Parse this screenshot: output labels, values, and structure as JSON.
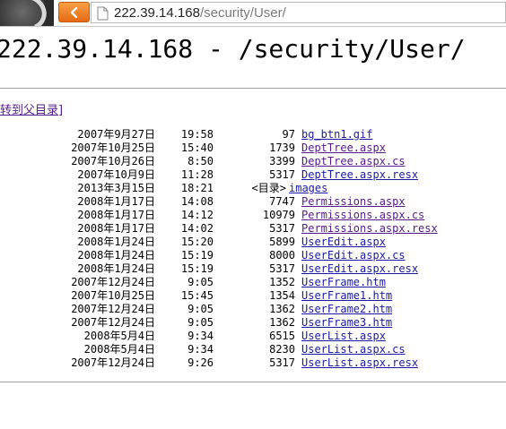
{
  "browser": {
    "url_host": "222.39.14.168",
    "url_path": "/security/User/"
  },
  "page": {
    "heading": "222.39.14.168 - /security/User/",
    "parent_link": "转到父目录]"
  },
  "dir_label": "<目录>",
  "files": [
    {
      "date": "2007年9月27日",
      "time": "19:58",
      "size": "97",
      "name": "bg_btn1.gif",
      "visited": false
    },
    {
      "date": "2007年10月25日",
      "time": "15:40",
      "size": "1739",
      "name": "DeptTree.aspx",
      "visited": true
    },
    {
      "date": "2007年10月26日",
      "time": "8:50",
      "size": "3399",
      "name": "DeptTree.aspx.cs",
      "visited": true
    },
    {
      "date": "2007年10月9日",
      "time": "11:28",
      "size": "5317",
      "name": "DeptTree.aspx.resx",
      "visited": false
    },
    {
      "date": "2013年3月15日",
      "time": "18:21",
      "size": "",
      "name": "images",
      "visited": false,
      "is_dir": true
    },
    {
      "date": "2008年1月17日",
      "time": "14:08",
      "size": "7747",
      "name": "Permissions.aspx",
      "visited": true
    },
    {
      "date": "2008年1月17日",
      "time": "14:12",
      "size": "10979",
      "name": "Permissions.aspx.cs",
      "visited": true
    },
    {
      "date": "2008年1月17日",
      "time": "14:02",
      "size": "5317",
      "name": "Permissions.aspx.resx",
      "visited": true
    },
    {
      "date": "2008年1月24日",
      "time": "15:20",
      "size": "5899",
      "name": "UserEdit.aspx",
      "visited": false
    },
    {
      "date": "2008年1月24日",
      "time": "15:19",
      "size": "8000",
      "name": "UserEdit.aspx.cs",
      "visited": false
    },
    {
      "date": "2008年1月24日",
      "time": "15:19",
      "size": "5317",
      "name": "UserEdit.aspx.resx",
      "visited": false
    },
    {
      "date": "2007年12月24日",
      "time": "9:05",
      "size": "1352",
      "name": "UserFrame.htm",
      "visited": false
    },
    {
      "date": "2007年10月25日",
      "time": "15:45",
      "size": "1354",
      "name": "UserFrame1.htm",
      "visited": false
    },
    {
      "date": "2007年12月24日",
      "time": "9:05",
      "size": "1362",
      "name": "UserFrame2.htm",
      "visited": false
    },
    {
      "date": "2007年12月24日",
      "time": "9:05",
      "size": "1362",
      "name": "UserFrame3.htm",
      "visited": false
    },
    {
      "date": "2008年5月4日",
      "time": "9:34",
      "size": "6515",
      "name": "UserList.aspx",
      "visited": false
    },
    {
      "date": "2008年5月4日",
      "time": "9:34",
      "size": "8230",
      "name": "UserList.aspx.cs",
      "visited": false
    },
    {
      "date": "2007年12月24日",
      "time": "9:26",
      "size": "5317",
      "name": "UserList.aspx.resx",
      "visited": false
    }
  ]
}
